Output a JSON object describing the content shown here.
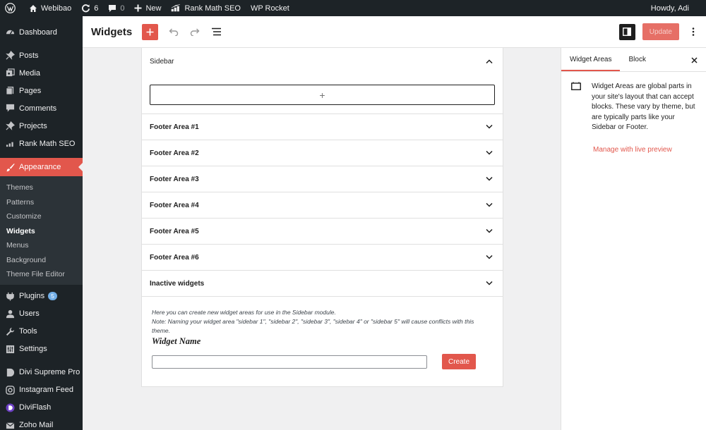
{
  "adminbar": {
    "site_name": "Webibao",
    "updates_count": "6",
    "comments_count": "0",
    "new_label": "New",
    "rank_math_label": "Rank Math SEO",
    "wp_rocket_label": "WP Rocket",
    "howdy": "Howdy, Adi"
  },
  "menu": {
    "dashboard": "Dashboard",
    "posts": "Posts",
    "media": "Media",
    "pages": "Pages",
    "comments": "Comments",
    "projects": "Projects",
    "rank_math": "Rank Math SEO",
    "appearance": "Appearance",
    "submenu": [
      "Themes",
      "Patterns",
      "Customize",
      "Widgets",
      "Menus",
      "Background",
      "Theme File Editor"
    ],
    "plugins": "Plugins",
    "plugins_badge": "5",
    "users": "Users",
    "tools": "Tools",
    "settings": "Settings",
    "divi_supreme": "Divi Supreme Pro",
    "instagram_feed": "Instagram Feed",
    "diviflash": "DiviFlash",
    "zoho_mail": "Zoho Mail"
  },
  "header": {
    "title": "Widgets",
    "update_label": "Update"
  },
  "widget_areas": {
    "sidebar_title": "Sidebar",
    "appender_symbol": "+",
    "areas": [
      "Footer Area #1",
      "Footer Area #2",
      "Footer Area #3",
      "Footer Area #4",
      "Footer Area #5",
      "Footer Area #6",
      "Inactive widgets"
    ]
  },
  "inactive": {
    "line1": "Here you can create new widget areas for use in the Sidebar module.",
    "line2": "Note: Naming your widget area \"sidebar 1\", \"sidebar 2\", \"sidebar 3\", \"sidebar 4\" or \"sidebar 5\" will cause conflicts with this theme.",
    "widget_name_label": "Widget Name",
    "name_value": "",
    "create_label": "Create"
  },
  "settings_panel": {
    "tab_widget_areas": "Widget Areas",
    "tab_block": "Block",
    "description": "Widget Areas are global parts in your site's layout that can accept blocks. These vary by theme, but are typically parts like your Sidebar or Footer.",
    "manage_link": "Manage with live preview"
  },
  "colors": {
    "accent": "#e2574c",
    "admin_dark": "#1d2327",
    "badge_blue": "#72aee6"
  }
}
